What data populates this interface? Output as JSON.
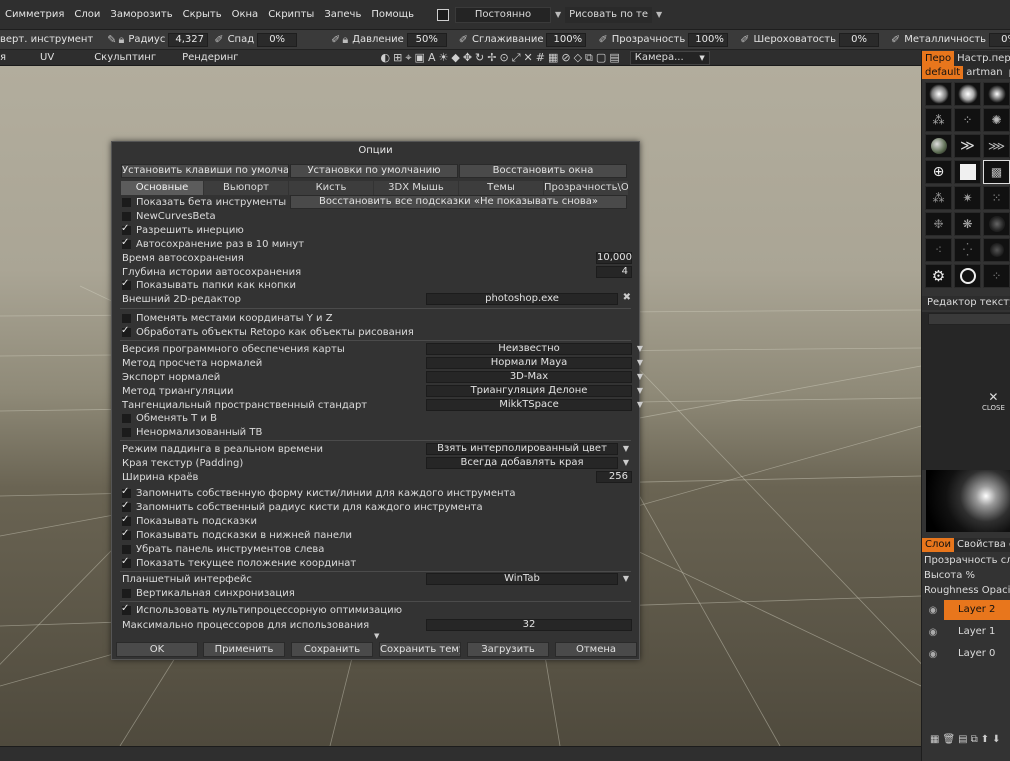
{
  "menubar": {
    "items": [
      "Симметрия",
      "Слои",
      "Заморозить",
      "Скрыть",
      "Окна",
      "Скрипты",
      "Запечь",
      "Помощь"
    ],
    "mode": "Постоянно",
    "draw": "Рисовать по те"
  },
  "toolbar": {
    "tool": "верт. инструмент",
    "radius_label": "Радиус",
    "radius_value": "4,327",
    "falloff_label": "Спад",
    "falloff_value": "0%",
    "pressure_label": "Давление",
    "pressure_value": "50%",
    "smoothing_label": "Сглаживание",
    "smoothing_value": "100%",
    "transparency_label": "Прозрачность",
    "transparency_value": "100%",
    "roughness_label": "Шероховатость",
    "roughness_value": "0%",
    "metalness_label": "Металличность",
    "metalness_value": "0%"
  },
  "rooms": {
    "items": [
      "я",
      "UV",
      "Скульптинг",
      "Рендеринг"
    ],
    "camera": "Камера..."
  },
  "right_panel": {
    "tabs": [
      "Перо",
      "Настр.пера"
    ],
    "subtabs": [
      "default",
      "artman",
      "pen"
    ],
    "texture_editor": "Редактор текстур",
    "close_label": "CLOSE",
    "layers_tabs": [
      "Слои",
      "Свойства с"
    ],
    "props": [
      "Прозрачность сл",
      "Высота %",
      "Roughness Opacit"
    ],
    "layers": [
      "Layer 2",
      "Layer 1",
      "Layer 0"
    ]
  },
  "dialog": {
    "title": "Опции",
    "top_buttons": [
      "Установить клавиши по умолчани",
      "Установки по умолчанию",
      "Восстановить окна"
    ],
    "tabs": [
      "Основные",
      "Вьюпорт",
      "Кисть",
      "3DX Мышь",
      "Темы",
      "Прозрачность\\От"
    ],
    "beta_tools": "Показать бета инструменты",
    "restore_hints": "Восстановить все подсказки «Не показывать снова»",
    "new_curves": "NewCurvesBeta",
    "allow_inertia": "Разрешить инерцию",
    "autosave": "Автосохранение раз в 10 минут",
    "autosave_time_label": "Время автосохранения",
    "autosave_time_value": "10,000",
    "history_depth_label": "Глубина истории автосохранения",
    "history_depth_value": "4",
    "folders_as_buttons": "Показывать папки как кнопки",
    "external_editor_label": "Внешний 2D-редактор",
    "external_editor_value": "photoshop.exe",
    "swap_yz": "Поменять местами координаты Y и Z",
    "retopo_as_paint": "Обработать объекты Retopo как объекты рисования",
    "software_version_label": "Версия программного обеспечения карты",
    "software_version_value": "Неизвестно",
    "normal_method_label": "Метод просчета нормалей",
    "normal_method_value": "Нормали Maya",
    "normal_export_label": "Экспорт нормалей",
    "normal_export_value": "3D-Max",
    "triangulation_label": "Метод триангуляции",
    "triangulation_value": "Триангуляция Делоне",
    "tangent_label": "Тангенциальный пространственный стандарт",
    "tangent_value": "MikkTSpace",
    "swap_tb": "Обменять T и B",
    "unnormalized_tb": "Ненормализованный TB",
    "padding_mode_label": "Режим паддинга в реальном времени",
    "padding_mode_value": "Взять интерполированный цвет",
    "texture_edges_label": "Края текстур (Padding)",
    "texture_edges_value": "Всегда добавлять края",
    "edge_width_label": "Ширина краёв",
    "edge_width_value": "256",
    "remember_shape": "Запомнить собственную форму кисти/линии для каждого инструмента",
    "remember_radius": "Запомнить собственный радиус кисти для каждого инструмента",
    "show_hints": "Показывать подсказки",
    "hints_bottom": "Показывать подсказки в нижней панели",
    "remove_left_panel": "Убрать панель инструментов слева",
    "show_coords": "Показать текущее положение координат",
    "tablet_label": "Планшетный интерфейс",
    "tablet_value": "WinTab",
    "vsync": "Вертикальная синхронизация",
    "multiproc": "Использовать мультипроцессорную оптимизацию",
    "max_proc_label": "Максимально процессоров для использования",
    "max_proc_value": "32",
    "buttons": [
      "OK",
      "Применить",
      "Сохранить",
      "Сохранить тему",
      "Загрузить",
      "Отмена"
    ]
  },
  "colors": {
    "accent": "#e8761c"
  }
}
